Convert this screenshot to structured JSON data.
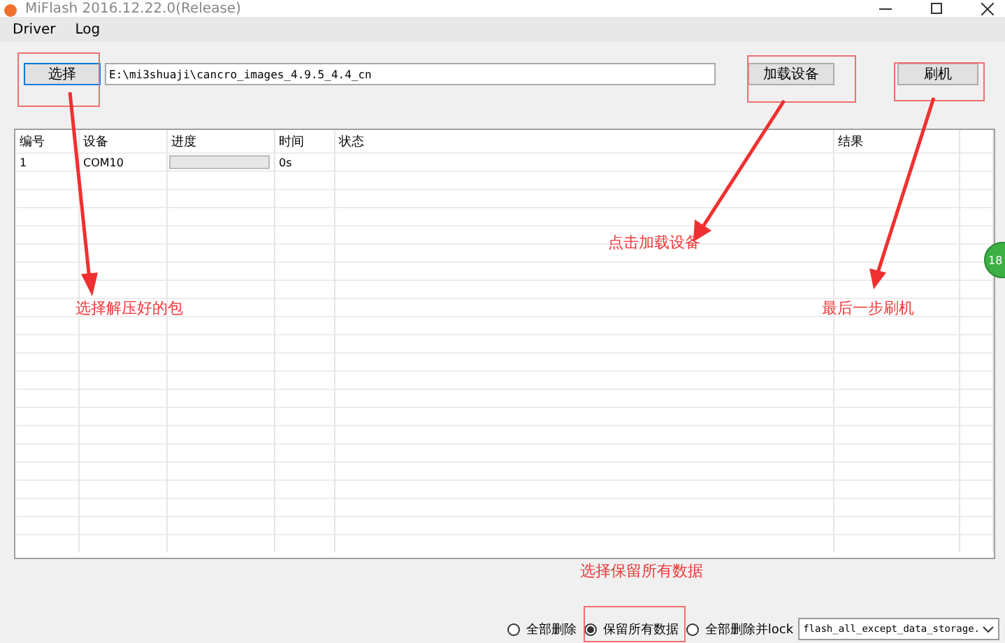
{
  "window": {
    "title": "MiFlash 2016.12.22.0(Release)"
  },
  "menu": [
    "Driver",
    "Log"
  ],
  "toolbar": {
    "select_button": "选择",
    "path": "E:\\mi3shuaji\\cancro_images_4.9.5_4.4_cn",
    "load_button": "加载设备",
    "flash_button": "刷机"
  },
  "table": {
    "columns": [
      "编号",
      "设备",
      "进度",
      "时间",
      "状态",
      "结果"
    ],
    "rows": [
      {
        "id": "1",
        "device": "COM10",
        "level": 0,
        "time": "0s"
      }
    ]
  },
  "options": [
    {
      "label": "全部删除",
      "selected": false
    },
    {
      "label": "保留所有数据",
      "selected": true
    },
    {
      "label": "全部删除并lock",
      "selected": false
    }
  ],
  "script_dropdown": "flash_all_except_data_storage.",
  "annotations": [
    "选择解压好的包",
    "点击加载设备",
    "最后一步刷机",
    "选择保留所有数据"
  ],
  "float_badge": "18"
}
